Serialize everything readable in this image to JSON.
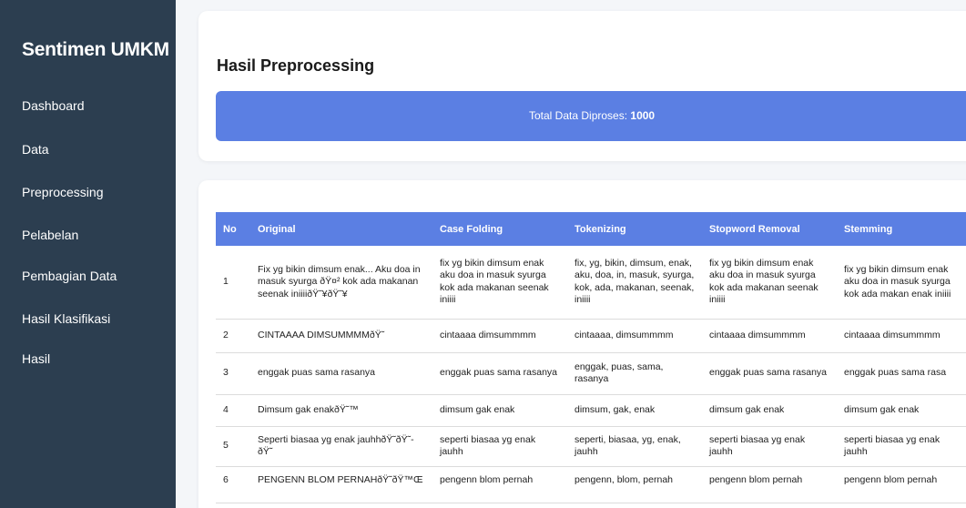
{
  "sidebar": {
    "brand": "Sentimen UMKM",
    "items": [
      {
        "label": "Dashboard"
      },
      {
        "label": "Data"
      },
      {
        "label": "Preprocessing"
      },
      {
        "label": "Pelabelan"
      },
      {
        "label": "Pembagian Data"
      },
      {
        "label": "Hasil Klasifikasi"
      },
      {
        "label": "Hasil"
      }
    ]
  },
  "main": {
    "title": "Hasil Preprocessing",
    "stat_label": "Total Data Diproses: ",
    "stat_value": "1000"
  },
  "table": {
    "headers": [
      "No",
      "Original",
      "Case Folding",
      "Tokenizing",
      "Stopword Removal",
      "Stemming"
    ],
    "rows": [
      [
        "1",
        "Fix yg bikin dimsum enak... Aku doa in masuk syurga ðŸ¤² kok ada makanan seenak iniiiiðŸ˜¥ðŸ˜¥",
        "fix yg bikin dimsum enak aku doa in masuk syurga kok ada makanan seenak iniiii",
        "fix, yg, bikin, dimsum, enak, aku, doa, in, masuk, syurga, kok, ada, makanan, seenak, iniiii",
        "fix yg bikin dimsum enak aku doa in masuk syurga kok ada makanan seenak iniiii",
        "fix yg bikin dimsum enak aku doa in masuk syurga kok ada makan enak iniiii"
      ],
      [
        "2",
        "CINTAAAA DIMSUMMMMðŸ˜",
        "cintaaaa dimsummmm",
        "cintaaaa, dimsummmm",
        "cintaaaa dimsummmm",
        "cintaaaa dimsummmm"
      ],
      [
        "3",
        "enggak puas sama rasanya",
        "enggak puas sama rasanya",
        "enggak, puas, sama, rasanya",
        "enggak puas sama rasanya",
        "enggak puas sama rasa"
      ],
      [
        "4",
        "Dimsum gak enakðŸ˜™",
        "dimsum gak enak",
        "dimsum, gak, enak",
        "dimsum gak enak",
        "dimsum gak enak"
      ],
      [
        "5",
        "Seperti biasaa yg enak jauhhðŸ˜ðŸ˜-ðŸ˜",
        "seperti biasaa yg enak jauhh",
        "seperti, biasaa, yg, enak, jauhh",
        "seperti biasaa yg enak jauhh",
        "seperti biasaa yg enak jauhh"
      ],
      [
        "6",
        "PENGENN BLOM PERNAHðŸ˜ðŸ™Œ",
        "pengenn blom pernah",
        "pengenn, blom, pernah",
        "pengenn blom pernah",
        "pengenn blom pernah"
      ]
    ]
  }
}
